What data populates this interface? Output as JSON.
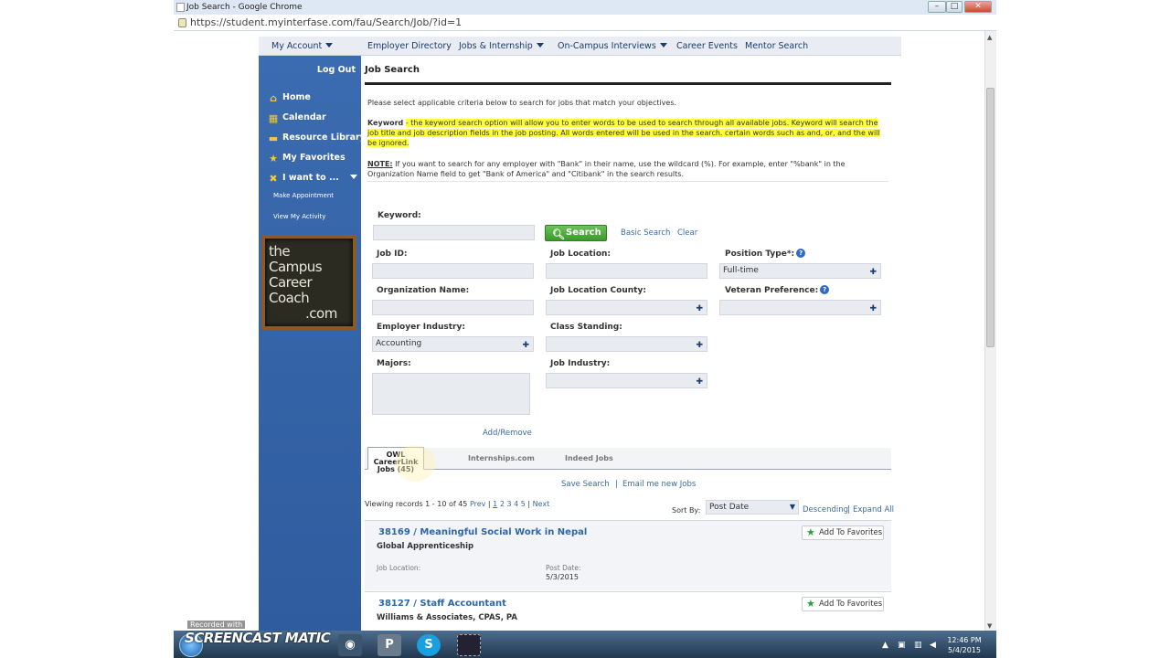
{
  "browser": {
    "window_title": "Job Search - Google Chrome",
    "url": "https://student.myinterfase.com/fau/Search/Job/?id=1",
    "controls": {
      "minimize": "–",
      "maximize": "□",
      "close": "✕"
    }
  },
  "topnav": {
    "items": [
      "My Account",
      "Employer Directory",
      "Jobs & Internship",
      "On-Campus Interviews",
      "Career Events",
      "Mentor Search"
    ]
  },
  "sidebar": {
    "logout": "Log Out",
    "items": [
      {
        "label": "Home",
        "icon": "home-icon"
      },
      {
        "label": "Calendar",
        "icon": "calendar-icon"
      },
      {
        "label": "Resource Library",
        "icon": "folder-icon"
      },
      {
        "label": "My Favorites",
        "icon": "star-icon"
      },
      {
        "label": "I want to ...",
        "icon": "tools-icon"
      }
    ],
    "subitems": [
      "Make Appointment",
      "View My Activity"
    ],
    "logo_text": [
      "the",
      "Campus",
      "Career",
      "Coach",
      ".com"
    ]
  },
  "page": {
    "title": "Job Search",
    "intro": "Please select applicable criteria below to search for jobs that match your objectives.",
    "keyword_note_label": "Keyword",
    "keyword_note_text": "- the keyword search option will allow you to enter words to be used to search through all available jobs.  Keyword will search the job title and job description fields in the job posting.  All words entered will be used in the search.  certain words such as and, or, and the will be ignored.",
    "note_label": "NOTE:",
    "note_text": "If you want to search for any employer with \"Bank\" in their name, use the wildcard (%).  For example, enter \"%bank\" in the Organization Name field to get \"Bank of America\" and \"Citibank\" in the search results."
  },
  "form": {
    "keyword_label": "Keyword:",
    "search_button": "Search",
    "basic_search": "Basic Search",
    "clear": "Clear",
    "job_id_label": "Job ID:",
    "job_location_label": "Job Location:",
    "position_type_label": "Position Type*:",
    "position_type_value": "Full-time",
    "org_name_label": "Organization Name:",
    "job_location_county_label": "Job Location County:",
    "veteran_pref_label": "Veteran Preference:",
    "employer_industry_label": "Employer Industry:",
    "employer_industry_value": "Accounting",
    "class_standing_label": "Class Standing:",
    "majors_label": "Majors:",
    "job_industry_label": "Job Industry:",
    "add_remove": "Add/Remove"
  },
  "tabs": {
    "active_line1": "OWL CareerLink",
    "active_line2": "Jobs (45)",
    "internships": "Internships.com",
    "indeed": "Indeed Jobs"
  },
  "results": {
    "save_search": "Save Search",
    "separator": "|",
    "email_jobs": "Email me new Jobs",
    "viewing": "Viewing records 1 - 10 of 45",
    "prev": "Prev",
    "pages": [
      "1",
      "2",
      "3",
      "4",
      "5"
    ],
    "next": "Next",
    "sort_by_label": "Sort By:",
    "sort_value": "Post Date",
    "descending": "Descending",
    "expand_all": "Expand All",
    "jobs": [
      {
        "title": "38169 / Meaningful Social Work in Nepal",
        "org": "Global Apprenticeship",
        "location_label": "Job Location:",
        "post_date_label": "Post Date:",
        "post_date": "5/3/2015",
        "favorite": "Add To Favorites"
      },
      {
        "title": "38127 / Staff Accountant",
        "org": "Williams & Associates, CPAS, PA",
        "favorite": "Add To Favorites"
      }
    ]
  },
  "taskbar": {
    "watermark": "SCREENCAST  MATIC",
    "recorded": "Recorded with",
    "time": "12:46 PM",
    "date": "5/4/2015"
  }
}
